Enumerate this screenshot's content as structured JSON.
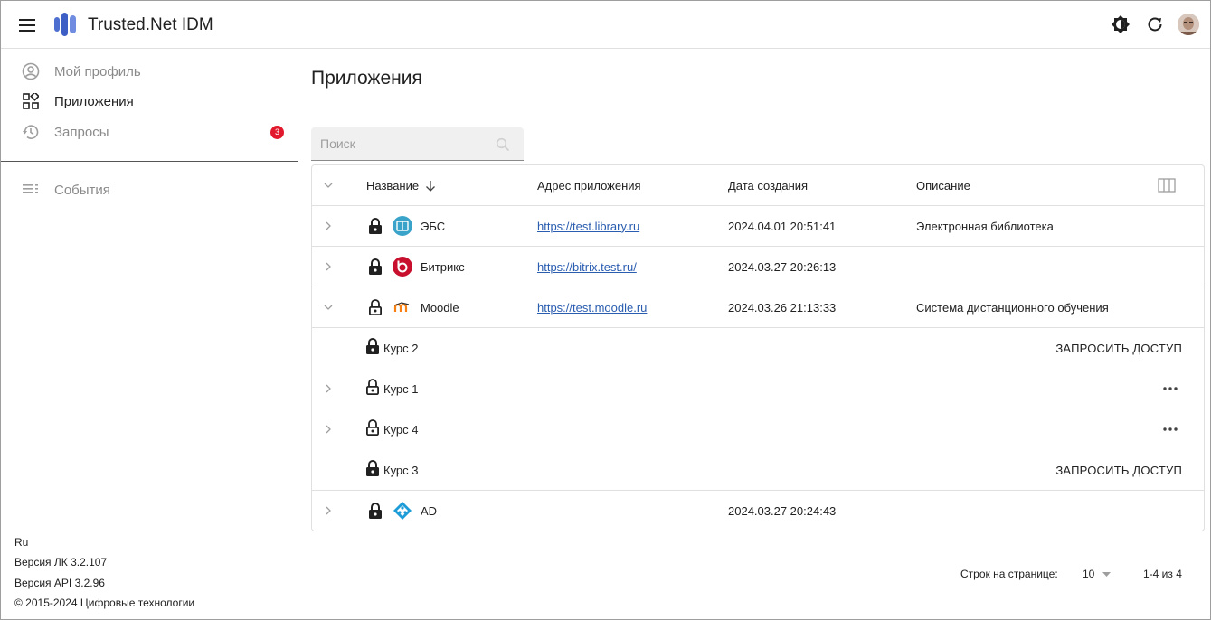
{
  "header": {
    "title": "Trusted.Net IDM",
    "menu_icon": "hamburger-menu-icon",
    "theme_icon": "brightness-icon",
    "refresh_icon": "refresh-icon"
  },
  "sidebar": {
    "items": [
      {
        "label": "Мой профиль",
        "icon": "account-circle-icon",
        "active": false
      },
      {
        "label": "Приложения",
        "icon": "apps-grid-icon",
        "active": true
      },
      {
        "label": "Запросы",
        "icon": "history-icon",
        "active": false,
        "badge": "3"
      },
      {
        "label": "События",
        "icon": "list-icon",
        "active": false
      }
    ],
    "footer": {
      "language": "Ru",
      "lk_version": "Версия ЛК 3.2.107",
      "api_version": "Версия API 3.2.96",
      "copyright": "© 2015-2024 Цифровые технологии"
    }
  },
  "main": {
    "title": "Приложения",
    "search": {
      "placeholder": "Поиск",
      "value": ""
    },
    "table": {
      "columns": [
        "Название",
        "Адрес приложения",
        "Дата создания",
        "Описание"
      ],
      "rows": [
        {
          "name": "ЭБС",
          "url": "https://test.library.ru",
          "date": "2024.04.01 20:51:41",
          "description": "Электронная библиотека",
          "locked": true
        },
        {
          "name": "Битрикс",
          "url": "https://bitrix.test.ru/",
          "date": "2024.03.27 20:26:13",
          "description": "",
          "locked": true
        },
        {
          "name": "Moodle",
          "url": "https://test.moodle.ru",
          "date": "2024.03.26 21:13:33",
          "description": "Система дистанционного обучения",
          "locked": false
        },
        {
          "name": "AD",
          "url": "",
          "date": "2024.03.27 20:24:43",
          "description": "",
          "locked": true
        }
      ],
      "subrows": [
        {
          "name": "Курс 2",
          "locked": true,
          "action": "ЗАПРОСИТЬ ДОСТУП"
        },
        {
          "name": "Курс 1",
          "locked": false,
          "action": "more"
        },
        {
          "name": "Курс 4",
          "locked": false,
          "action": "more"
        },
        {
          "name": "Курс 3",
          "locked": true,
          "action": "ЗАПРОСИТЬ ДОСТУП"
        }
      ]
    },
    "pagination": {
      "rows_per_page_label": "Строк на странице:",
      "rows_per_page": "10",
      "range": "1-4 из 4"
    }
  },
  "colors": {
    "accent": "#3d5ec4",
    "badge": "#e2192c",
    "link": "#2a5db0"
  }
}
